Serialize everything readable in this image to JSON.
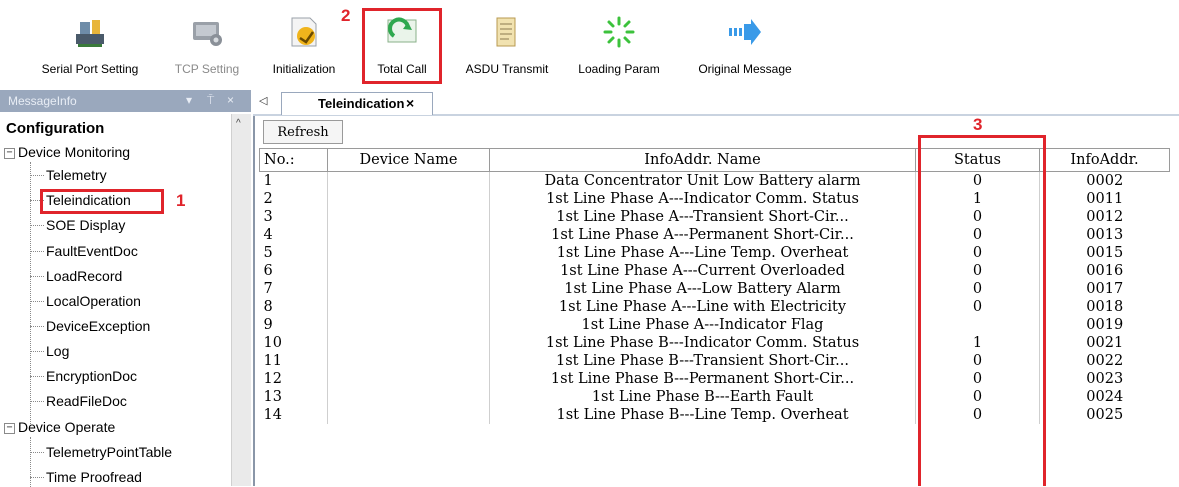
{
  "toolbar": {
    "buttons": [
      {
        "label": "Serial Port Setting",
        "icon": "serial-port-icon",
        "enabled": true
      },
      {
        "label": "TCP Setting",
        "icon": "tcp-icon",
        "enabled": false
      },
      {
        "label": "Initialization",
        "icon": "initialization-icon",
        "enabled": true
      },
      {
        "label": "Total Call",
        "icon": "total-call-icon",
        "enabled": true
      },
      {
        "label": "ASDU Transmit",
        "icon": "asdu-transmit-icon",
        "enabled": true
      },
      {
        "label": "Loading Param",
        "icon": "loading-param-icon",
        "enabled": true
      },
      {
        "label": "Original Message",
        "icon": "original-message-icon",
        "enabled": true
      }
    ]
  },
  "annotations": {
    "n1": "1",
    "n2": "2",
    "n3": "3",
    "color": "#e0242b"
  },
  "left_panel": {
    "title": "MessageInfo",
    "controls": [
      "▾",
      "⍑",
      "×"
    ],
    "root": "Configuration",
    "groups": [
      {
        "label": "Device Monitoring",
        "items": [
          "Telemetry",
          "Teleindication",
          "SOE Display",
          "FaultEventDoc",
          "LoadRecord",
          "LocalOperation",
          "DeviceException",
          "Log",
          "EncryptionDoc",
          "ReadFileDoc"
        ]
      },
      {
        "label": "Device Operate",
        "items": [
          "TelemetryPointTable",
          "Time Proofread"
        ]
      }
    ]
  },
  "tabs": {
    "nav_left": "◁",
    "active": "Teleindication",
    "close": "×"
  },
  "table": {
    "refresh_label": "Refresh",
    "columns": [
      "No.:",
      "Device Name",
      "InfoAddr. Name",
      "Status",
      "InfoAddr."
    ],
    "rows": [
      {
        "no": "1",
        "device": "",
        "name": "Data Concentrator Unit Low Battery alarm",
        "status": "0",
        "addr": "0002"
      },
      {
        "no": "2",
        "device": "",
        "name": "1st Line Phase A---Indicator Comm. Status",
        "status": "1",
        "addr": "0011"
      },
      {
        "no": "3",
        "device": "",
        "name": "1st Line Phase A---Transient Short-Cir...",
        "status": "0",
        "addr": "0012"
      },
      {
        "no": "4",
        "device": "",
        "name": "1st Line Phase A---Permanent Short-Cir...",
        "status": "0",
        "addr": "0013"
      },
      {
        "no": "5",
        "device": "",
        "name": "1st Line Phase A---Line Temp. Overheat",
        "status": "0",
        "addr": "0015"
      },
      {
        "no": "6",
        "device": "",
        "name": "1st Line Phase A---Current Overloaded",
        "status": "0",
        "addr": "0016"
      },
      {
        "no": "7",
        "device": "",
        "name": "1st Line Phase A---Low Battery Alarm",
        "status": "0",
        "addr": "0017"
      },
      {
        "no": "8",
        "device": "",
        "name": "1st Line Phase A---Line with Electricity",
        "status": "0",
        "addr": "0018"
      },
      {
        "no": "9",
        "device": "",
        "name": "1st Line Phase A---Indicator Flag",
        "status": "",
        "addr": "0019"
      },
      {
        "no": "10",
        "device": "",
        "name": "1st Line Phase B---Indicator Comm. Status",
        "status": "1",
        "addr": "0021"
      },
      {
        "no": "11",
        "device": "",
        "name": "1st Line Phase B---Transient Short-Cir...",
        "status": "0",
        "addr": "0022"
      },
      {
        "no": "12",
        "device": "",
        "name": "1st Line Phase B---Permanent Short-Cir...",
        "status": "0",
        "addr": "0023"
      },
      {
        "no": "13",
        "device": "",
        "name": "1st Line Phase B---Earth Fault",
        "status": "0",
        "addr": "0024"
      },
      {
        "no": "14",
        "device": "",
        "name": "1st Line Phase B---Line Temp. Overheat",
        "status": "0",
        "addr": "0025"
      }
    ]
  }
}
